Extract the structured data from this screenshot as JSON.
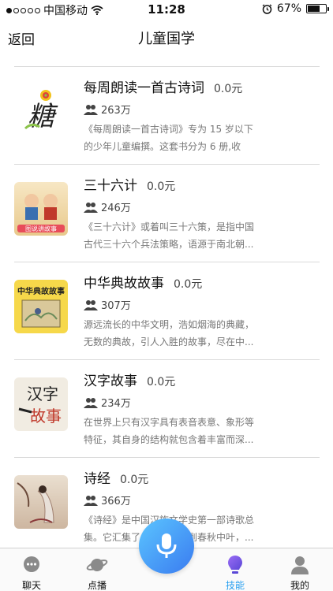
{
  "status_bar": {
    "carrier": "中国移动",
    "time": "11:28",
    "battery": "67%",
    "battery_level": 0.67
  },
  "nav": {
    "back": "返回",
    "title": "儿童国学"
  },
  "items": [
    {
      "title": "每周朗读一首古诗词",
      "price": "0.0元",
      "plays": "263万",
      "desc": "《每周朗读一首古诗词》专为 15 岁以下的少年儿童编撰。这套书分为 6 册,收集..."
    },
    {
      "title": "三十六计",
      "price": "0.0元",
      "plays": "246万",
      "desc": "《三十六计》或着叫三十六策，是指中国古代三十六个兵法策略，语源于南北朝..."
    },
    {
      "title": "中华典故故事",
      "price": "0.0元",
      "plays": "307万",
      "desc": "源远流长的中华文明，浩如烟海的典藏，无数的典故，引人入胜的故事，尽在中..."
    },
    {
      "title": "汉字故事",
      "price": "0.0元",
      "plays": "234万",
      "desc": "在世界上只有汉字具有表音表意、象形等特征，其自身的结构就包含着丰富而深..."
    },
    {
      "title": "诗经",
      "price": "0.0元",
      "plays": "366万",
      "desc": "《诗经》是中国汉族文学史第一部诗歌总集。它汇集了从西周初年到春秋中叶，..."
    }
  ],
  "thumb_text": {
    "tang": "糖",
    "story": "图说讲故事",
    "book": "中华典故故事",
    "hanzi1": "汉字",
    "hanzi2": "故事"
  },
  "tabs": [
    {
      "label": "聊天",
      "icon": "chat-icon"
    },
    {
      "label": "点播",
      "icon": "planet-icon"
    },
    {
      "label": "技能",
      "icon": "bulb-icon",
      "active": true
    },
    {
      "label": "我的",
      "icon": "user-icon"
    }
  ],
  "colors": {
    "accent": "#2aa0f0",
    "mic_start": "#5bc5ff",
    "mic_end": "#3a7bf0"
  }
}
